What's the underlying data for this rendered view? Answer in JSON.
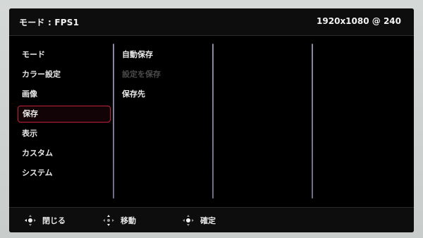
{
  "header": {
    "mode_label": "モード : FPS1",
    "resolution": "1920x1080 @ 240"
  },
  "menu": {
    "items": [
      {
        "label": "モード",
        "active": false
      },
      {
        "label": "カラー設定",
        "active": false
      },
      {
        "label": "画像",
        "active": false
      },
      {
        "label": "保存",
        "active": true
      },
      {
        "label": "表示",
        "active": false
      },
      {
        "label": "カスタム",
        "active": false
      },
      {
        "label": "システム",
        "active": false
      }
    ]
  },
  "submenu": {
    "items": [
      {
        "label": "自動保存",
        "enabled": true
      },
      {
        "label": "設定を保存",
        "enabled": false
      },
      {
        "label": "保存先",
        "enabled": true
      }
    ]
  },
  "footer": {
    "close_label": "閉じる",
    "move_label": "移動",
    "confirm_label": "確定"
  },
  "colors": {
    "accent_selection": "#c2233b",
    "divider": "#8e8aa6",
    "text": "#e8e8e8",
    "disabled_text": "#4a4a4a",
    "background": "#000000"
  },
  "icons": {
    "close": "joystick-left-icon",
    "move": "joystick-updown-icon",
    "confirm": "joystick-press-icon"
  }
}
